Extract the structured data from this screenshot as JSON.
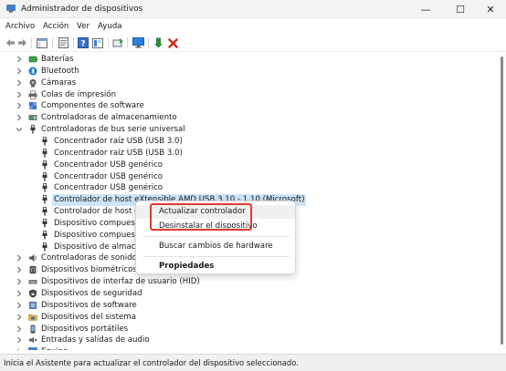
{
  "window": {
    "title": "Administrador de dispositivos",
    "minimize": "—",
    "maximize": "☐",
    "close": "✕"
  },
  "menu": [
    "Archivo",
    "Acción",
    "Ver",
    "Ayuda"
  ],
  "tree": [
    {
      "label": "Baterías",
      "icon": "battery-icon",
      "expanded": false,
      "level": 1
    },
    {
      "label": "Bluetooth",
      "icon": "bluetooth-icon",
      "expanded": false,
      "level": 1
    },
    {
      "label": "Cámaras",
      "icon": "camera-icon",
      "expanded": false,
      "level": 1
    },
    {
      "label": "Colas de impresión",
      "icon": "printer-icon",
      "expanded": false,
      "level": 1
    },
    {
      "label": "Componentes de software",
      "icon": "puzzle-icon",
      "expanded": false,
      "level": 1
    },
    {
      "label": "Controladoras de almacenamiento",
      "icon": "storage-controller-icon",
      "expanded": false,
      "level": 1
    },
    {
      "label": "Controladoras de bus serie universal",
      "icon": "usb-icon",
      "expanded": true,
      "level": 1
    },
    {
      "label": "Concentrador raíz USB (USB 3.0)",
      "icon": "usb-icon",
      "level": 2
    },
    {
      "label": "Concentrador raíz USB (USB 3.0)",
      "icon": "usb-icon",
      "level": 2
    },
    {
      "label": "Concentrador USB genérico",
      "icon": "usb-icon",
      "level": 2
    },
    {
      "label": "Concentrador USB genérico",
      "icon": "usb-icon",
      "level": 2
    },
    {
      "label": "Concentrador USB genérico",
      "icon": "usb-icon",
      "level": 2
    },
    {
      "label": "Controlador de host eXtensible AMD USB 3.10 - 1.10 (Microsoft)",
      "icon": "usb-icon",
      "level": 2,
      "selected": true
    },
    {
      "label": "Controlador de host eXt",
      "icon": "usb-icon",
      "level": 2
    },
    {
      "label": "Dispositivo compuesto",
      "icon": "usb-icon",
      "level": 2
    },
    {
      "label": "Dispositivo compuesto",
      "icon": "usb-icon",
      "level": 2
    },
    {
      "label": "Dispositivo de almacena",
      "icon": "usb-icon",
      "level": 2
    },
    {
      "label": "Controladoras de sonido y v",
      "icon": "speaker-icon",
      "expanded": false,
      "level": 1
    },
    {
      "label": "Dispositivos biométricos",
      "icon": "biometric-icon",
      "expanded": false,
      "level": 1
    },
    {
      "label": "Dispositivos de interfaz de usuario (HID)",
      "icon": "hid-icon",
      "expanded": false,
      "level": 1
    },
    {
      "label": "Dispositivos de seguridad",
      "icon": "security-icon",
      "expanded": false,
      "level": 1
    },
    {
      "label": "Dispositivos de software",
      "icon": "software-device-icon",
      "expanded": false,
      "level": 1
    },
    {
      "label": "Dispositivos del sistema",
      "icon": "system-folder-icon",
      "expanded": false,
      "level": 1
    },
    {
      "label": "Dispositivos portátiles",
      "icon": "portable-icon",
      "expanded": false,
      "level": 1
    },
    {
      "label": "Entradas y salidas de audio",
      "icon": "audio-io-icon",
      "expanded": false,
      "level": 1
    },
    {
      "label": "Equipo",
      "icon": "computer-icon",
      "expanded": false,
      "level": 1
    }
  ],
  "context_menu": {
    "update_driver": "Actualizar controlador",
    "uninstall_device": "Desinstalar el dispositivo",
    "scan_hardware": "Buscar cambios de hardware",
    "properties": "Propiedades"
  },
  "status": "Inicia el Asistente para actualizar el controlador del dispositivo seleccionado.",
  "colors": {
    "selection": "#cce4f7",
    "highlight_box": "#e03a2f",
    "usb_icon": "#3a3a3a"
  }
}
